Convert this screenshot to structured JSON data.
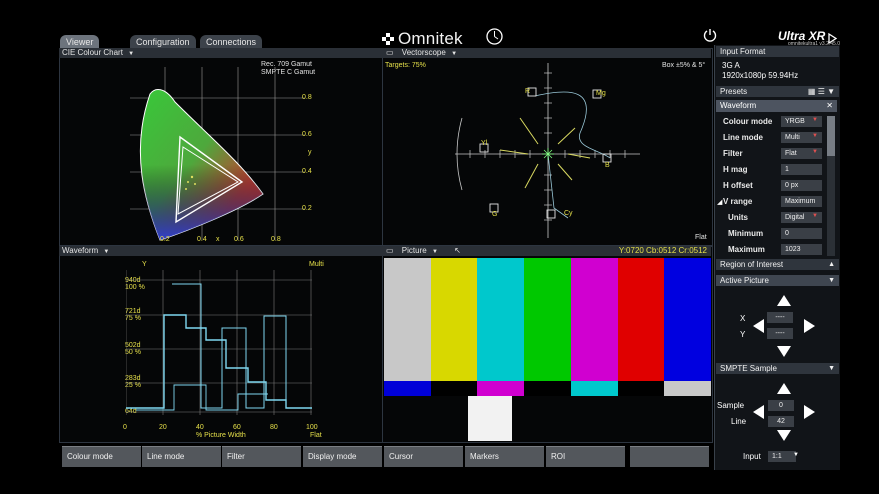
{
  "app": {
    "logo_text": "Omnitek",
    "product": "Ultra XR",
    "version": "omnitekultra1 v3.2.45.0"
  },
  "tabs": [
    {
      "label": "Viewer"
    },
    {
      "label": "Configuration"
    },
    {
      "label": "Connections"
    }
  ],
  "cie": {
    "title": "CIE Colour Chart",
    "gamut_lines": [
      "Rec. 709 Gamut",
      "SMPTE C Gamut"
    ],
    "y_ticks": [
      "0.8",
      "0.6",
      "0.4",
      "0.2"
    ],
    "y_label": "y",
    "x_ticks": [
      "0.2",
      "0.4",
      "0.6",
      "0.8"
    ],
    "x_label": "x"
  },
  "vectorscope": {
    "title": "Vectorscope",
    "targets": "Targets: 75%",
    "box": "Box ±5% & 5°",
    "mode": "Flat",
    "target_labels": [
      "R",
      "Mg",
      "B",
      "Cy",
      "G",
      "Yl"
    ]
  },
  "waveform_panel": {
    "title": "Waveform",
    "channel": "Y",
    "mode": "Multi",
    "left_labels": [
      {
        "code": "940d",
        "pct": "100 %"
      },
      {
        "code": "721d",
        "pct": "75 %"
      },
      {
        "code": "502d",
        "pct": "50 %"
      },
      {
        "code": "283d",
        "pct": "25 %"
      },
      {
        "code": "64d",
        "pct": ""
      }
    ],
    "x_ticks": [
      "0",
      "20",
      "40",
      "60",
      "80",
      "100"
    ],
    "x_caption": "% Picture Width",
    "flat_label": "Flat"
  },
  "picture": {
    "title": "Picture",
    "readout": "Y:0720 Cb:0512 Cr:0512",
    "bars": [
      "#c8c8c8",
      "#d8d800",
      "#00c8cc",
      "#00c800",
      "#d000d0",
      "#e00000",
      "#0000e0"
    ],
    "bottom_bars": [
      "#0000d8",
      "#000000",
      "#d000d0",
      "#000000",
      "#00c8cc",
      "#000000",
      "#c8c8c8"
    ]
  },
  "sidebar": {
    "input_format_title": "Input Format",
    "input_format_lines": [
      "3G A",
      "1920x1080p 59.94Hz"
    ],
    "presets_title": "Presets",
    "waveform_title": "Waveform",
    "rows": [
      {
        "label": "Colour mode",
        "value": "YRGB",
        "dropdown": true
      },
      {
        "label": "Line mode",
        "value": "Multi",
        "dropdown": true
      },
      {
        "label": "Filter",
        "value": "Flat",
        "dropdown": true
      },
      {
        "label": "H mag",
        "value": "1",
        "dropdown": false
      },
      {
        "label": "H offset",
        "value": "0 px",
        "dropdown": false
      },
      {
        "label": "V range",
        "value": "Maximum",
        "dropdown": false
      },
      {
        "label": "Units",
        "value": "Digital",
        "dropdown": true
      },
      {
        "label": "Minimum",
        "value": "0",
        "dropdown": false
      },
      {
        "label": "Maximum",
        "value": "1023",
        "dropdown": false
      }
    ],
    "roi_title": "Region of Interest",
    "active_picture_title": "Active Picture",
    "x_label": "X",
    "y_label": "Y",
    "x_value": "----",
    "y_value": "----",
    "smpte_title": "SMPTE Sample",
    "sample_label": "Sample",
    "line_label": "Line",
    "sample_value": "0",
    "line_value": "42",
    "input_label": "Input",
    "input_value": "1:1"
  },
  "bottom_buttons": [
    "Colour mode",
    "Line mode",
    "Filter",
    "Display mode",
    "Cursor",
    "Markers",
    "ROI",
    ""
  ]
}
